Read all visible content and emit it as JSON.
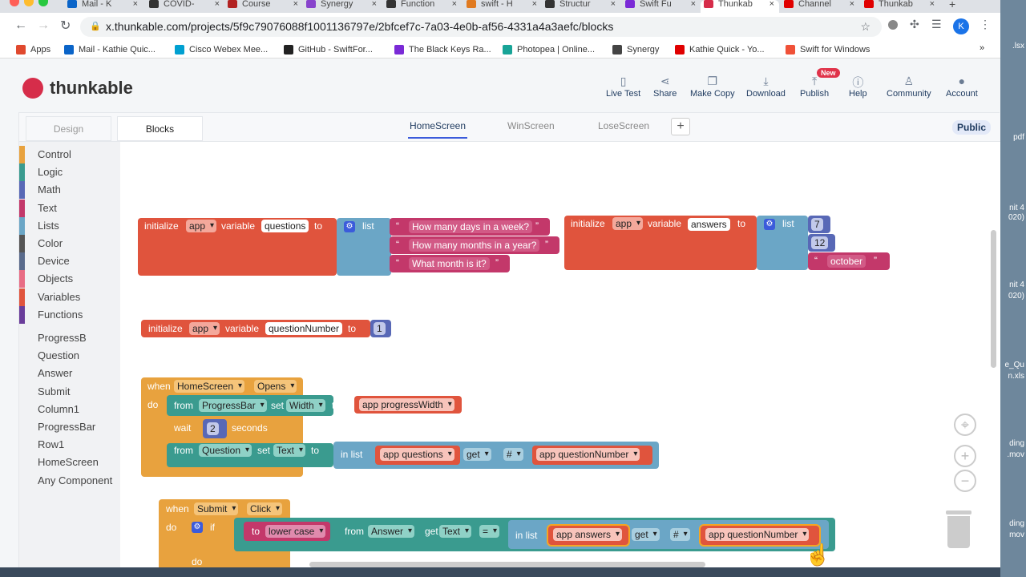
{
  "browser": {
    "tabs": [
      {
        "label": "Mail - K",
        "color": "#0a64c8"
      },
      {
        "label": "COVID-",
        "color": "#333333"
      },
      {
        "label": "Course",
        "color": "#b22222"
      },
      {
        "label": "Synergy",
        "color": "#8844cc"
      },
      {
        "label": "Function",
        "color": "#333333"
      },
      {
        "label": "swift - H",
        "color": "#e07a20"
      },
      {
        "label": "Structur",
        "color": "#333333"
      },
      {
        "label": "Swift Fu",
        "color": "#7a2ad6"
      },
      {
        "label": "Thunkab",
        "color": "#d62d4a"
      },
      {
        "label": "Channel",
        "color": "#e00000"
      },
      {
        "label": "Thunkab",
        "color": "#e00000"
      }
    ],
    "url": "x.thunkable.com/projects/5f9c79076088f1001136797e/2bfcef7c-7a03-4e0b-af56-4331a4a3aefc/blocks",
    "profile_initial": "K",
    "bookmarks": [
      {
        "label": "Apps",
        "color": "#e0492e"
      },
      {
        "label": "Mail - Kathie Quic...",
        "color": "#0a64c8"
      },
      {
        "label": "Cisco Webex Mee...",
        "color": "#00a0d1"
      },
      {
        "label": "GitHub - SwiftFor...",
        "color": "#222222"
      },
      {
        "label": "The Black Keys Ra...",
        "color": "#7a2ad6"
      },
      {
        "label": "Photopea | Online...",
        "color": "#18a497"
      },
      {
        "label": "Synergy",
        "color": "#444444"
      },
      {
        "label": "Kathie Quick - Yo...",
        "color": "#e00000"
      },
      {
        "label": "Swift for Windows",
        "color": "#f05138"
      }
    ],
    "bookmarks_more": "»"
  },
  "desktop_labels": [
    ".lsx",
    "pdf",
    "nit 4",
    "020)",
    "nit 4",
    "020)",
    "e_Qu",
    "n.xls",
    "ding",
    ".mov",
    "ding",
    "mov"
  ],
  "app": {
    "logo_text": "thunkable",
    "toolbar": [
      {
        "label": "Live Test",
        "icon": "phone-icon"
      },
      {
        "label": "Share",
        "icon": "share-icon"
      },
      {
        "label": "Make Copy",
        "icon": "copy-icon"
      },
      {
        "label": "Download",
        "icon": "download-icon"
      },
      {
        "label": "Publish",
        "icon": "publish-icon"
      },
      {
        "label": "Help",
        "icon": "help-icon"
      },
      {
        "label": "Community",
        "icon": "community-icon"
      },
      {
        "label": "Account",
        "icon": "account-icon"
      }
    ],
    "new_badge": "New",
    "mode_tabs": [
      "Design",
      "Blocks"
    ],
    "screen_tabs": [
      "HomeScreen",
      "WinScreen",
      "LoseScreen"
    ],
    "active_screen": "HomeScreen",
    "add_screen": "+",
    "visibility": "Public",
    "categories": [
      {
        "label": "Control",
        "color": "#e8a23e"
      },
      {
        "label": "Logic",
        "color": "#3a9b8f"
      },
      {
        "label": "Math",
        "color": "#5868b6"
      },
      {
        "label": "Text",
        "color": "#c3386a"
      },
      {
        "label": "Lists",
        "color": "#6ba6c6"
      },
      {
        "label": "Color",
        "color": "#555555"
      },
      {
        "label": "Device",
        "color": "#5a6b8c"
      },
      {
        "label": "Objects",
        "color": "#e86c84"
      },
      {
        "label": "Variables",
        "color": "#e0543d"
      },
      {
        "label": "Functions",
        "color": "#6a3d9a"
      }
    ],
    "components": [
      "ProgressB",
      "Question",
      "Answer",
      "Submit",
      "Column1",
      "ProgressBar",
      "Row1",
      "HomeScreen",
      "Any Component"
    ]
  },
  "blocks": {
    "init1": {
      "initialize": "initialize",
      "scope": "app",
      "variable": "variable",
      "name": "questions",
      "to": "to",
      "list": "list",
      "items": [
        "How many days in a week?",
        "How many months in a year?",
        "What month is it?"
      ]
    },
    "init2": {
      "initialize": "initialize",
      "scope": "app",
      "variable": "variable",
      "name": "answers",
      "to": "to",
      "list": "list",
      "items": [
        "7",
        "12",
        "october"
      ]
    },
    "init3": {
      "initialize": "initialize",
      "scope": "app",
      "variable": "variable",
      "name": "questionNumber",
      "to": "to",
      "value": "1"
    },
    "event1": {
      "when": "when",
      "component": "HomeScreen",
      "event": "Opens",
      "do": "do",
      "set1": {
        "from": "from",
        "component": "ProgressBar",
        "set": "set",
        "property": "Width",
        "to": "to",
        "value": "app progressWidth"
      },
      "wait": {
        "wait": "wait",
        "value": "2",
        "unit": "seconds"
      },
      "set2": {
        "from": "from",
        "component": "Question",
        "set": "set",
        "property": "Text",
        "to": "to",
        "in_list": "in list",
        "list_var": "app questions",
        "get": "get",
        "index_type": "#",
        "index_var": "app questionNumber"
      }
    },
    "event2": {
      "when": "when",
      "component": "Submit",
      "event": "Click",
      "do": "do",
      "if": "if",
      "do2": "do",
      "to": "to",
      "case": "lower case",
      "from": "from",
      "component2": "Answer",
      "get": "get",
      "property": "Text",
      "op": "=",
      "in_list": "in list",
      "list_var": "app answers",
      "get2": "get",
      "index_type": "#",
      "index_var": "app questionNumber"
    },
    "quote_open": "“",
    "quote_close": "”"
  },
  "workspace_controls": [
    "target-icon",
    "zoom-in-icon",
    "zoom-out-icon",
    "trash-icon"
  ]
}
